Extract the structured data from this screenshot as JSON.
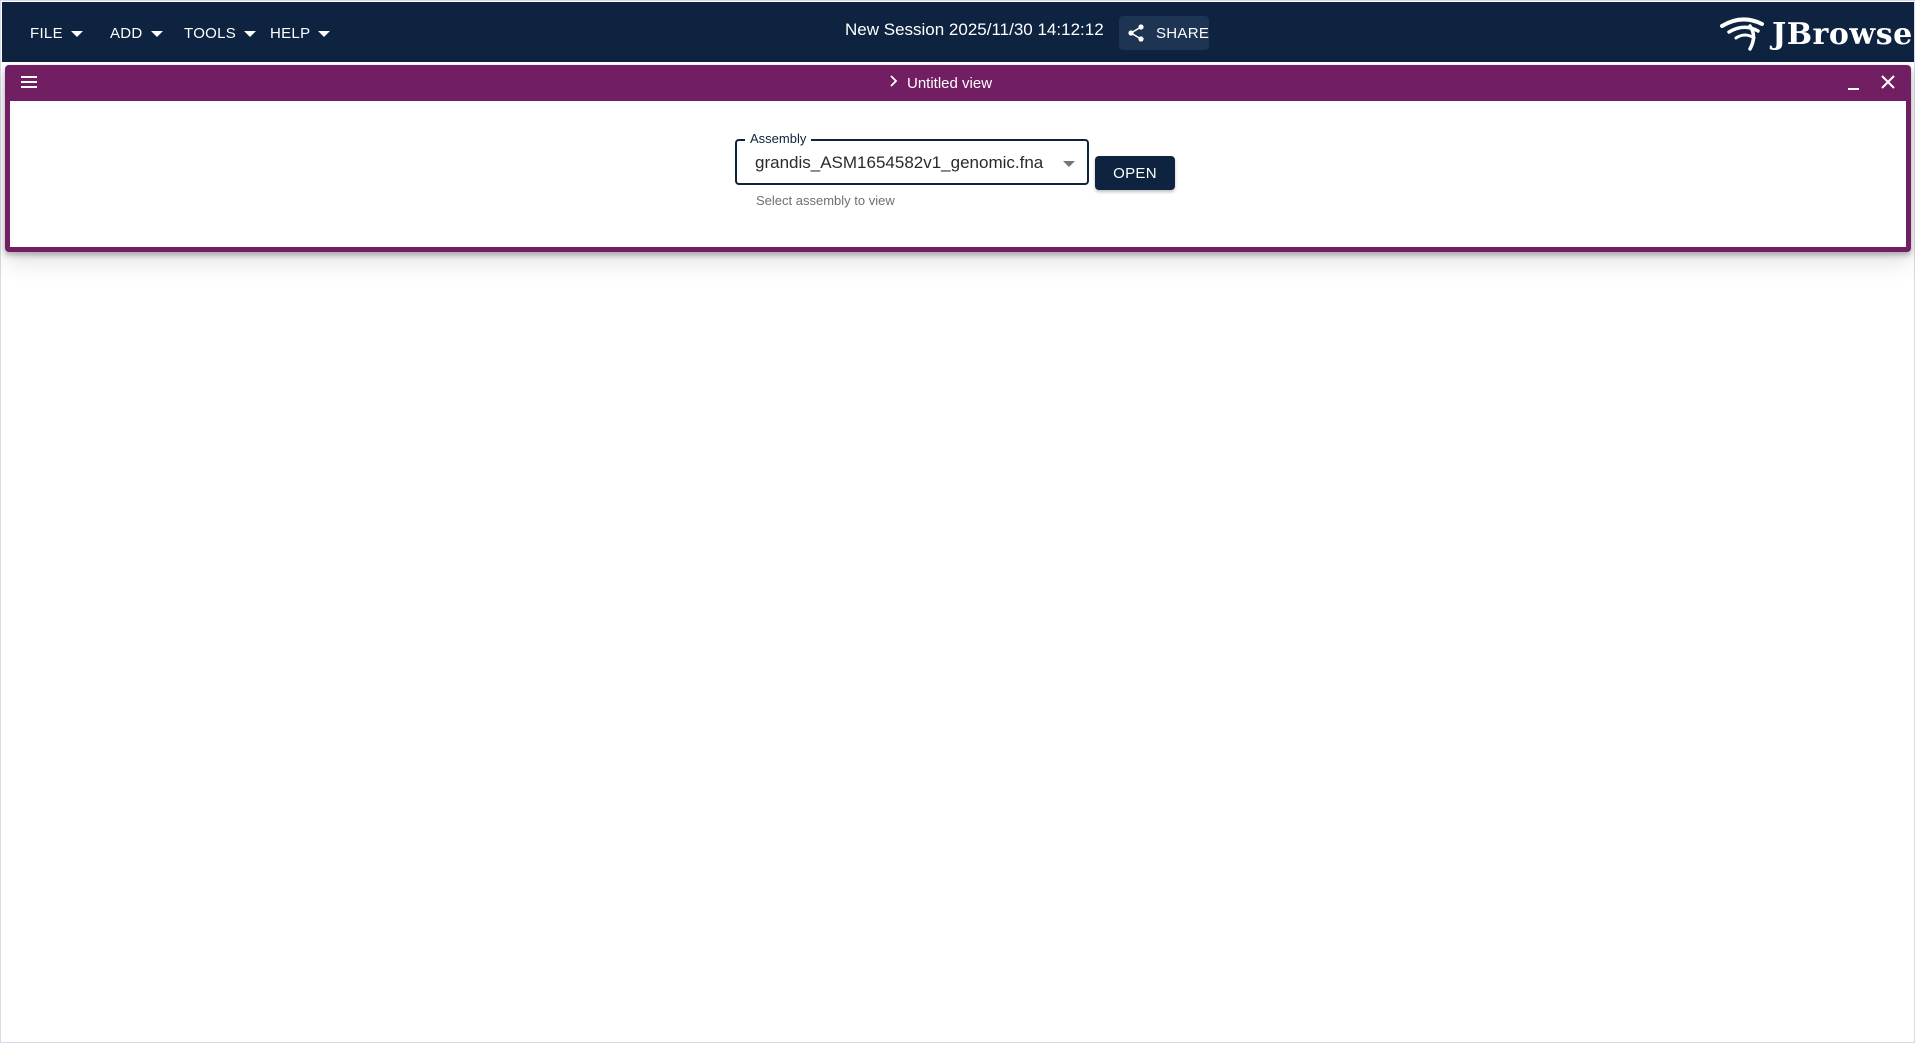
{
  "colors": {
    "appbar": "#0d233f",
    "view_header": "#721e63",
    "primary_button": "#0d233f",
    "helper_text": "#6f6f6f"
  },
  "appbar": {
    "menus": [
      {
        "label": "FILE",
        "icon": "caret-down-icon"
      },
      {
        "label": "ADD",
        "icon": "caret-down-icon"
      },
      {
        "label": "TOOLS",
        "icon": "caret-down-icon"
      },
      {
        "label": "HELP",
        "icon": "caret-down-icon"
      }
    ],
    "session_title": "New Session 2025/11/30 14:12:12",
    "share": {
      "label": "SHARE",
      "icon": "share-icon"
    },
    "logo": {
      "text": "JBrowse",
      "icon": "jbrowse-logo-icon"
    }
  },
  "view": {
    "menu_icon": "hamburger-menu-icon",
    "title_icon": "chevron-right-icon",
    "title": "Untitled view",
    "minimize_icon": "minimize-icon",
    "close_icon": "close-icon",
    "assembly": {
      "label": "Assembly",
      "value": "grandis_ASM1654582v1_genomic.fna",
      "helper": "Select assembly to view",
      "icon": "dropdown-arrow-icon"
    },
    "open_label": "OPEN"
  }
}
